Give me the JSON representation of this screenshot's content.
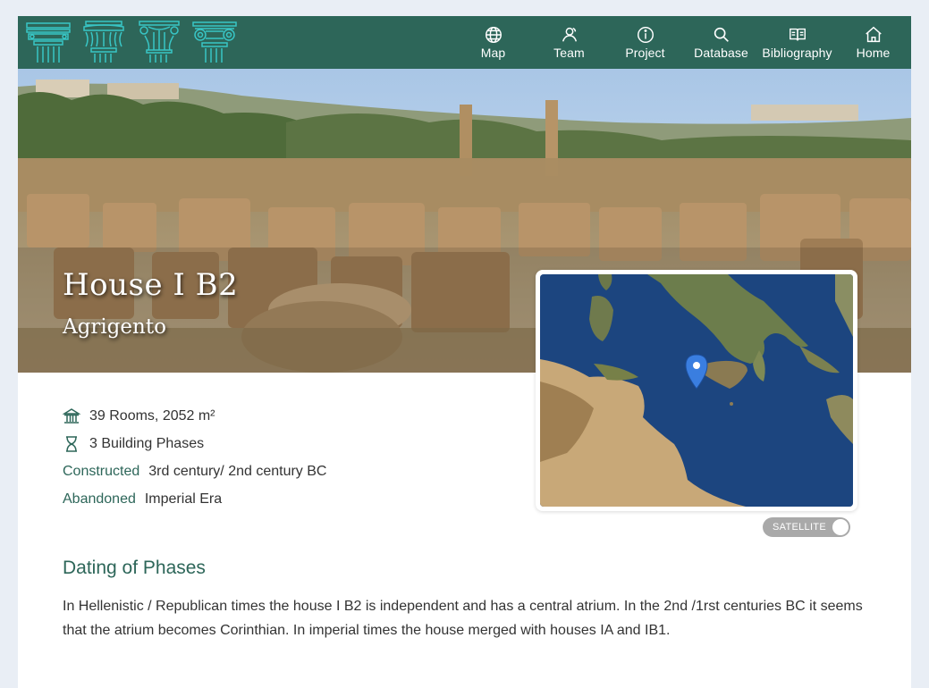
{
  "header": {
    "logo_icons": [
      "doric-capital-icon",
      "corinthian-capital-icon",
      "composite-capital-icon",
      "ionic-capital-icon"
    ],
    "nav": [
      {
        "label": "Map",
        "icon": "globe-icon"
      },
      {
        "label": "Team",
        "icon": "team-icon"
      },
      {
        "label": "Project",
        "icon": "info-icon"
      },
      {
        "label": "Database",
        "icon": "search-icon"
      },
      {
        "label": "Bibliography",
        "icon": "book-icon"
      },
      {
        "label": "Home",
        "icon": "home-icon"
      }
    ]
  },
  "hero": {
    "title": "House I B2",
    "subtitle": "Agrigento"
  },
  "map": {
    "toggle_label": "SATELLITE",
    "marker_icon": "map-pin-icon"
  },
  "facts": {
    "rooms": "39 Rooms, 2052 m²",
    "phases": "3 Building Phases",
    "constructed_label": "Constructed",
    "constructed_value": "3rd century/ 2nd century BC",
    "abandoned_label": "Abandoned",
    "abandoned_value": "Imperial Era"
  },
  "dating": {
    "title": "Dating of Phases",
    "text": "In Hellenistic / Republican times the house I B2 is independent and has a central atrium. In the 2nd /1rst centuries BC it seems that the atrium becomes Corinthian. In imperial times the house merged with houses IA and IB1."
  },
  "colors": {
    "header": "#2d6659",
    "accent": "#2d6659",
    "logo": "#38c6c6",
    "page_bg": "#e9eef5"
  }
}
